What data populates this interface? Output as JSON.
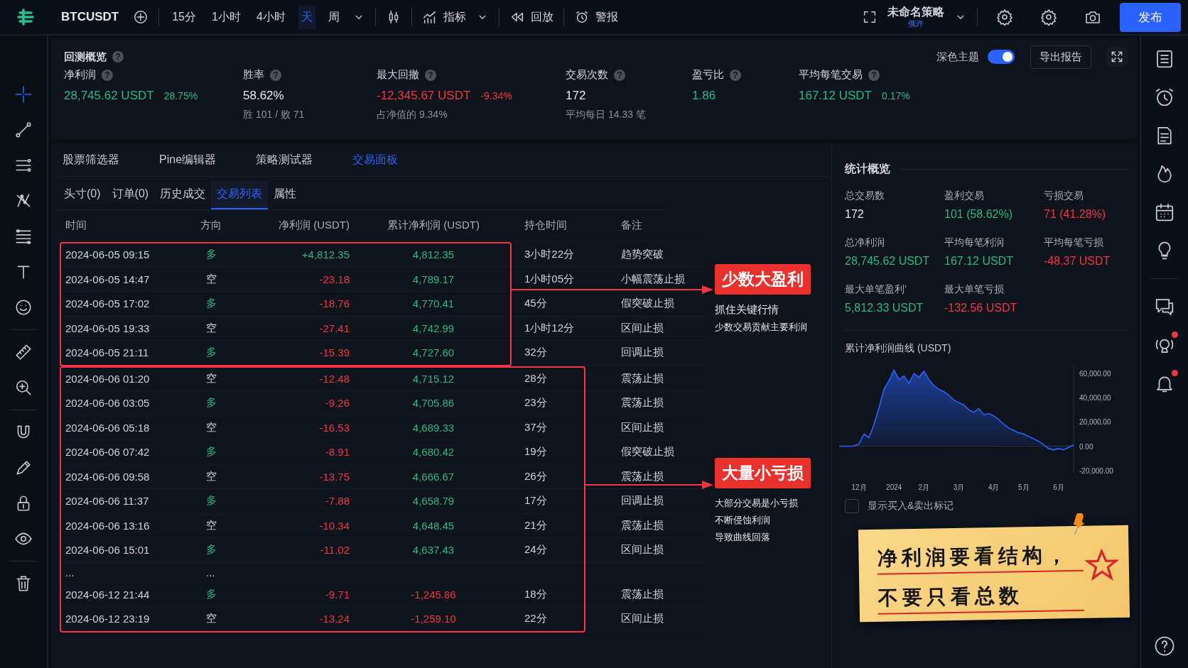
{
  "topbar": {
    "symbol": "BTCUSDT",
    "timeframes": [
      {
        "label": "15分",
        "selected": false
      },
      {
        "label": "1小时",
        "selected": false
      },
      {
        "label": "4小时",
        "selected": false
      },
      {
        "label": "天",
        "selected": true
      },
      {
        "label": "周",
        "selected": false
      }
    ],
    "indicators": "指标",
    "replay": "回放",
    "alerts": "警报",
    "strategy": {
      "name": "未命名策略",
      "status": "俄许"
    },
    "publish": "发布"
  },
  "left_tools": [
    {
      "selected": true
    },
    {
      "selected": false
    },
    {
      "selected": false
    },
    {
      "selected": false
    },
    {
      "selected": false
    },
    {
      "selected": false
    },
    {
      "selected": false
    },
    {
      "selected": false
    },
    {
      "selected": false
    },
    {
      "selected": false
    },
    {
      "selected": false
    },
    {
      "selected": false
    },
    {
      "selected": false
    },
    {
      "selected": false
    }
  ],
  "summary": {
    "title": "回测概览",
    "help": "?",
    "dark_theme": {
      "label": "深色主题",
      "on": true
    },
    "export": "导出报告",
    "metrics": [
      {
        "label": "净利润",
        "help": "?",
        "value": "28,745.62 USDT",
        "pct": "28.75%",
        "color": "#26b98a"
      },
      {
        "label": "胜率",
        "help": "?",
        "value": "58.62%",
        "sub": "胜 101 / 败 71",
        "color": "#e6e8ee"
      },
      {
        "label": "最大回撤",
        "help": "?",
        "value": "-12,345.67 USDT",
        "pct": "-9.34%",
        "sub": "占净值的 9.34%",
        "color": "#f23645"
      },
      {
        "label": "交易次数",
        "help": "?",
        "value": "172",
        "sub": "平均每日 14.33 笔",
        "color": "#e6e8ee"
      },
      {
        "label": "盈亏比",
        "help": "?",
        "value": "1.86",
        "color": "#26b98a"
      },
      {
        "label": "平均每笔交易",
        "help": "?",
        "value": "167.12 USDT",
        "pct": "0.17%",
        "color": "#26b98a"
      }
    ]
  },
  "panel_tabs": [
    {
      "label": "股票筛选器",
      "selected": false
    },
    {
      "label": "Pine编辑器",
      "selected": false
    },
    {
      "label": "策略测试器",
      "selected": false
    },
    {
      "label": "交易面板",
      "selected": true
    }
  ],
  "sub_tabs": [
    {
      "label": "头寸(0)",
      "selected": false
    },
    {
      "label": "订单(0)",
      "selected": false
    },
    {
      "label": "历史成交",
      "selected": false
    },
    {
      "label": "交易列表",
      "selected": true
    },
    {
      "label": "属性",
      "selected": false
    }
  ],
  "trades": {
    "columns": [
      "时间",
      "方向",
      "净利润 (USDT)",
      "累计净利润 (USDT)",
      "持仓时间",
      "备注"
    ],
    "groups": [
      {
        "callout": {
          "title": "少数大盈利",
          "lines": [
            "抓住关键行情",
            "少数交易贡献主要利润"
          ]
        },
        "rows": [
          {
            "kind": "trade",
            "time": "2024-06-05 09:15",
            "side": "多",
            "long": true,
            "net": "+4,812.35",
            "net_positive": true,
            "cum": "4,812.35",
            "cum_positive": true,
            "hold": "3小时22分",
            "note": "趋势突破"
          },
          {
            "kind": "trade",
            "time": "2024-06-05 14:47",
            "side": "空",
            "long": false,
            "net": "-23.18",
            "net_positive": false,
            "cum": "4,789.17",
            "cum_positive": true,
            "hold": "1小时05分",
            "note": "小幅震荡止损"
          },
          {
            "kind": "trade",
            "time": "2024-06-05 17:02",
            "side": "多",
            "long": true,
            "net": "-18.76",
            "net_positive": false,
            "cum": "4,770.41",
            "cum_positive": true,
            "hold": "45分",
            "note": "假突破止损"
          },
          {
            "kind": "trade",
            "time": "2024-06-05 19:33",
            "side": "空",
            "long": false,
            "net": "-27.41",
            "net_positive": false,
            "cum": "4,742.99",
            "cum_positive": true,
            "hold": "1小时12分",
            "note": "区间止损"
          },
          {
            "kind": "trade",
            "time": "2024-06-05 21:11",
            "side": "多",
            "long": true,
            "net": "-15.39",
            "net_positive": false,
            "cum": "4,727.60",
            "cum_positive": true,
            "hold": "32分",
            "note": "回调止损"
          }
        ]
      },
      {
        "callout": {
          "title": "大量小亏损",
          "lines": [
            "大部分交易是小亏损",
            "不断侵蚀利润",
            "导致曲线回落"
          ]
        },
        "rows": [
          {
            "kind": "trade",
            "time": "2024-06-06 01:20",
            "side": "空",
            "long": false,
            "net": "-12.48",
            "net_positive": false,
            "cum": "4,715.12",
            "cum_positive": true,
            "hold": "28分",
            "note": "震荡止损"
          },
          {
            "kind": "trade",
            "time": "2024-06-06 03:05",
            "side": "多",
            "long": true,
            "net": "-9.26",
            "net_positive": false,
            "cum": "4,705.86",
            "cum_positive": true,
            "hold": "23分",
            "note": "震荡止损"
          },
          {
            "kind": "trade",
            "time": "2024-06-06 05:18",
            "side": "空",
            "long": false,
            "net": "-16.53",
            "net_positive": false,
            "cum": "4,689.33",
            "cum_positive": true,
            "hold": "37分",
            "note": "区间止损"
          },
          {
            "kind": "trade",
            "time": "2024-06-06 07:42",
            "side": "多",
            "long": true,
            "net": "-8.91",
            "net_positive": false,
            "cum": "4,680.42",
            "cum_positive": true,
            "hold": "19分",
            "note": "假突破止损"
          },
          {
            "kind": "trade",
            "time": "2024-06-06 09:58",
            "side": "空",
            "long": false,
            "net": "-13.75",
            "net_positive": false,
            "cum": "4,666.67",
            "cum_positive": true,
            "hold": "26分",
            "note": "震荡止损"
          },
          {
            "kind": "trade",
            "time": "2024-06-06 11:37",
            "side": "多",
            "long": true,
            "net": "-7.88",
            "net_positive": false,
            "cum": "4,658.79",
            "cum_positive": true,
            "hold": "17分",
            "note": "回调止损"
          },
          {
            "kind": "trade",
            "time": "2024-06-06 13:16",
            "side": "空",
            "long": false,
            "net": "-10.34",
            "net_positive": false,
            "cum": "4,648.45",
            "cum_positive": true,
            "hold": "21分",
            "note": "震荡止损"
          },
          {
            "kind": "trade",
            "time": "2024-06-06 15:01",
            "side": "多",
            "long": true,
            "net": "-11.02",
            "net_positive": false,
            "cum": "4,637.43",
            "cum_positive": true,
            "hold": "24分",
            "note": "区间止损"
          },
          {
            "kind": "gap",
            "time": "...",
            "side": "..."
          },
          {
            "kind": "trade",
            "time": "2024-06-12 21:44",
            "side": "多",
            "long": true,
            "net": "-9.71",
            "net_positive": false,
            "cum": "-1,245.86",
            "cum_positive": false,
            "hold": "18分",
            "note": "震荡止损"
          },
          {
            "kind": "trade",
            "time": "2024-06-12 23:19",
            "side": "空",
            "long": false,
            "net": "-13.24",
            "net_positive": false,
            "cum": "-1,259.10",
            "cum_positive": false,
            "hold": "22分",
            "note": "区间止损"
          }
        ]
      }
    ]
  },
  "stats": {
    "title": "统计概览",
    "items": [
      {
        "label": "总交易数",
        "value": "172",
        "color": "#e6e8ee"
      },
      {
        "label": "盈利交易",
        "value": "101 (58.62%)",
        "color": "#26b98a"
      },
      {
        "label": "亏损交易",
        "value": "71 (41.28%)",
        "color": "#f23645"
      },
      {
        "label": "总净利润",
        "value": "28,745.62 USDT",
        "color": "#26b98a"
      },
      {
        "label": "平均每笔利润",
        "value": "167.12 USDT",
        "color": "#26b98a"
      },
      {
        "label": "平均每笔亏损",
        "value": "-48.37 USDT",
        "color": "#f23645"
      },
      {
        "label": "最大单笔盈利’",
        "value": "5,812.33 USDT",
        "color": "#26b98a"
      },
      {
        "label": "最大单笔亏损",
        "value": "-132.56 USDT",
        "color": "#f23645"
      }
    ],
    "chart": {
      "title": "累计净利润曲线 (USDT)",
      "chart_data": {
        "type": "area",
        "categories": [
          null,
          null,
          null,
          null,
          "12月",
          null,
          null,
          null,
          null,
          null,
          null,
          "2024",
          null,
          null,
          null,
          null,
          null,
          "2月",
          null,
          null,
          null,
          null,
          null,
          null,
          "3月",
          null,
          null,
          null,
          null,
          null,
          null,
          "4月",
          null,
          null,
          null,
          null,
          null,
          "5月",
          null,
          null,
          null,
          null,
          null,
          null,
          "6月",
          null,
          null,
          null
        ],
        "series": [
          {
            "color": "#2962ff",
            "values": [
              0,
              0,
              0,
              0,
              2000,
              10000,
              7000,
              18000,
              32000,
              47000,
              54000,
              63000,
              55000,
              58000,
              52000,
              60000,
              57000,
              62000,
              55000,
              50000,
              47000,
              45000,
              42000,
              38000,
              36000,
              34000,
              30000,
              28000,
              31000,
              26000,
              27000,
              25000,
              22000,
              18000,
              15000,
              13000,
              11000,
              10000,
              8000,
              6000,
              4000,
              1000,
              -2000,
              -3000,
              -2000,
              -3000,
              -1000,
              1000
            ]
          }
        ],
        "ylim": [
          -22000,
          66000
        ],
        "yticks": [
          {
            "value": 60000,
            "label": "60,000.00"
          },
          {
            "value": 40000,
            "label": "40,000.00"
          },
          {
            "value": 20000,
            "label": "20,000.00"
          },
          {
            "value": 0,
            "label": "0.00"
          },
          {
            "value": -20000,
            "label": "-20,000.00"
          }
        ]
      }
    },
    "markers": {
      "label": "显示买入&卖出标记",
      "checked": false
    }
  },
  "note": {
    "lines": [
      "净利润要看结构，",
      "不要只看总数"
    ]
  },
  "right_tools": [
    {
      "badge": false
    },
    {
      "badge": false
    },
    {
      "badge": false
    },
    {
      "badge": false
    },
    {
      "badge": false
    },
    {
      "badge": false
    },
    {
      "badge": false
    },
    {
      "badge": true
    },
    {
      "badge": true
    }
  ]
}
